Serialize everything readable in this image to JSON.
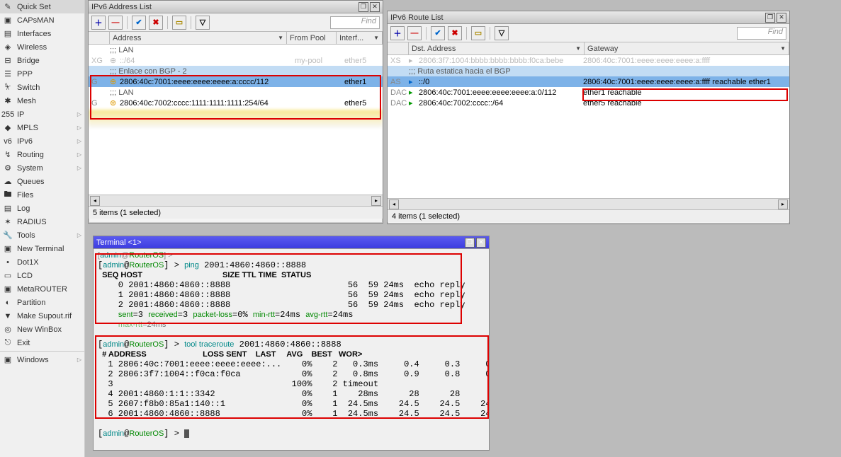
{
  "menu": [
    {
      "id": "quickset",
      "label": "Quick Set"
    },
    {
      "id": "capsman",
      "label": "CAPsMAN"
    },
    {
      "id": "interfaces",
      "label": "Interfaces"
    },
    {
      "id": "wireless",
      "label": "Wireless"
    },
    {
      "id": "bridge",
      "label": "Bridge"
    },
    {
      "id": "ppp",
      "label": "PPP"
    },
    {
      "id": "switch",
      "label": "Switch"
    },
    {
      "id": "mesh",
      "label": "Mesh"
    },
    {
      "id": "ip",
      "label": "IP",
      "sub": true
    },
    {
      "id": "mpls",
      "label": "MPLS",
      "sub": true
    },
    {
      "id": "ipv6",
      "label": "IPv6",
      "sub": true
    },
    {
      "id": "routing",
      "label": "Routing",
      "sub": true
    },
    {
      "id": "system",
      "label": "System",
      "sub": true
    },
    {
      "id": "queues",
      "label": "Queues"
    },
    {
      "id": "files",
      "label": "Files"
    },
    {
      "id": "log",
      "label": "Log"
    },
    {
      "id": "radius",
      "label": "RADIUS"
    },
    {
      "id": "tools",
      "label": "Tools",
      "sub": true
    },
    {
      "id": "newterm",
      "label": "New Terminal"
    },
    {
      "id": "dot1x",
      "label": "Dot1X"
    },
    {
      "id": "lcd",
      "label": "LCD"
    },
    {
      "id": "metarouter",
      "label": "MetaROUTER"
    },
    {
      "id": "partition",
      "label": "Partition"
    },
    {
      "id": "supout",
      "label": "Make Supout.rif"
    },
    {
      "id": "newwinbox",
      "label": "New WinBox"
    },
    {
      "id": "exit",
      "label": "Exit"
    },
    {
      "sep": true
    },
    {
      "id": "windows",
      "label": "Windows",
      "sub": true
    }
  ],
  "find_placeholder": "Find",
  "addr_win": {
    "title": "IPv6 Address List",
    "cols": {
      "address": "Address",
      "frompool": "From Pool",
      "interface": "Interf..."
    },
    "rows": [
      {
        "flag": "",
        "comment": ";;; LAN"
      },
      {
        "flag": "XG",
        "addr": "::/64",
        "pool": "my-pool",
        "iface": "ether5",
        "disabled": true
      },
      {
        "flag": "",
        "comment": ";;; Enlace con BGP - 2"
      },
      {
        "flag": "G",
        "addr": "2806:40c:7001:eeee:eeee:eeee:a:cccc/112",
        "pool": "",
        "iface": "ether1",
        "sel": true
      },
      {
        "flag": "",
        "comment": ";;; LAN"
      },
      {
        "flag": "G",
        "addr": "2806:40c:7002:cccc:1111:1111:1111:254/64",
        "pool": "",
        "iface": "ether5"
      }
    ],
    "status": "5 items (1 selected)"
  },
  "route_win": {
    "title": "IPv6 Route List",
    "cols": {
      "dst": "Dst. Address",
      "gw": "Gateway"
    },
    "rows": [
      {
        "flag": "XS",
        "dst": "2806:3f7:1004:bbbb:bbbb:bbbb:f0ca:bebe",
        "gw": "2806:40c:7001:eeee:eeee:eeee:a:ffff",
        "disabled": true
      },
      {
        "flag": "",
        "comment": ";;; Ruta estatica hacia el BGP"
      },
      {
        "flag": "AS",
        "dst": "::/0",
        "gw": "2806:40c:7001:eeee:eeee:eeee:a:ffff reachable ether1",
        "sel": true
      },
      {
        "flag": "DAC",
        "dst": "2806:40c:7001:eeee:eeee:eeee:a:0/112",
        "gw": "ether1 reachable"
      },
      {
        "flag": "DAC",
        "dst": "2806:40c:7002:cccc::/64",
        "gw": "ether5 reachable"
      }
    ],
    "status": "4 items (1 selected)"
  },
  "term_win": {
    "title": "Terminal <1>",
    "prompt_user": "admin",
    "prompt_host": "RouterOS",
    "cmd1": "ping 2001:4860:4860::8888",
    "ping_header": "  SEQ HOST                                     SIZE TTL TIME  STATUS",
    "ping_rows": [
      "    0 2001:4860:4860::8888                       56  59 24ms  echo reply",
      "    1 2001:4860:4860::8888                       56  59 24ms  echo reply",
      "    2 2001:4860:4860::8888                       56  59 24ms  echo reply"
    ],
    "ping_summary_parts": {
      "sent": "sent",
      "sent_v": "=3 ",
      "recv": "received",
      "recv_v": "=3 ",
      "pl": "packet-loss",
      "pl_v": "=0% ",
      "min": "min-rtt",
      "min_v": "=24ms ",
      "avg": "avg-rtt",
      "avg_v": "=24ms",
      "max": "max-rtt",
      "max_v": "=24ms"
    },
    "cmd2": "tool traceroute 2001:4860:4860::8888",
    "tr_header": "  # ADDRESS                          LOSS SENT    LAST     AVG    BEST   WOR>",
    "tr_rows": [
      "  1 2806:40c:7001:eeee:eeee:eeee:...    0%    2   0.3ms     0.4     0.3     0>",
      "  2 2806:3f7:1004::f0ca:f0ca            0%    2   0.8ms     0.9     0.8     0>",
      "  3                                   100%    2 timeout",
      "  4 2001:4860:1:1::3342                 0%    1    28ms      28      28      >",
      "  5 2607:f8b0:85a1:140::1               0%    1  24.5ms    24.5    24.5    24>",
      "  6 2001:4860:4860::8888                0%    1  24.5ms    24.5    24.5    24>"
    ]
  }
}
